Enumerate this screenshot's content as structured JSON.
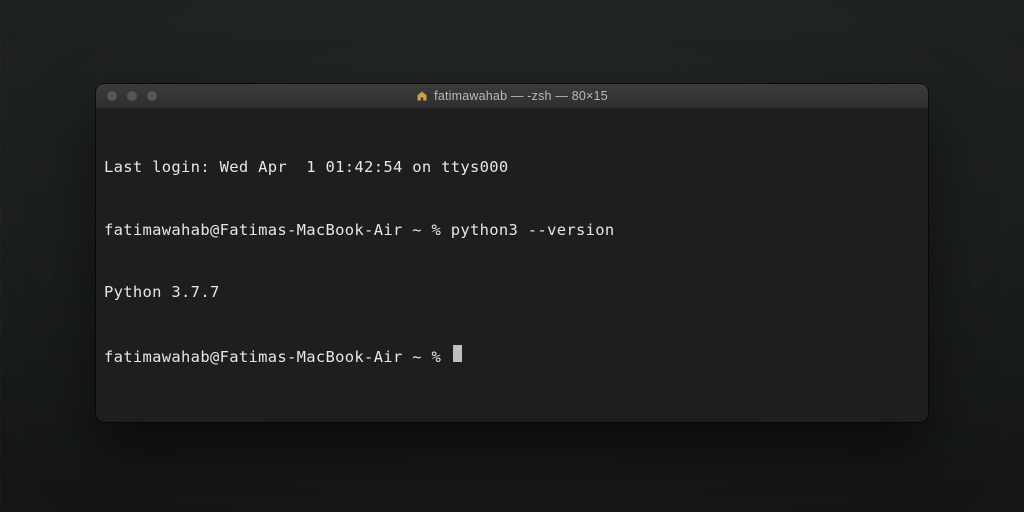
{
  "window": {
    "title": "fatimawahab — -zsh — 80×15"
  },
  "terminal": {
    "last_login": "Last login: Wed Apr  1 01:42:54 on ttys000",
    "prompt1": "fatimawahab@Fatimas-MacBook-Air ~ % ",
    "command1": "python3 --version",
    "output1": "Python 3.7.7",
    "prompt2": "fatimawahab@Fatimas-MacBook-Air ~ % "
  }
}
